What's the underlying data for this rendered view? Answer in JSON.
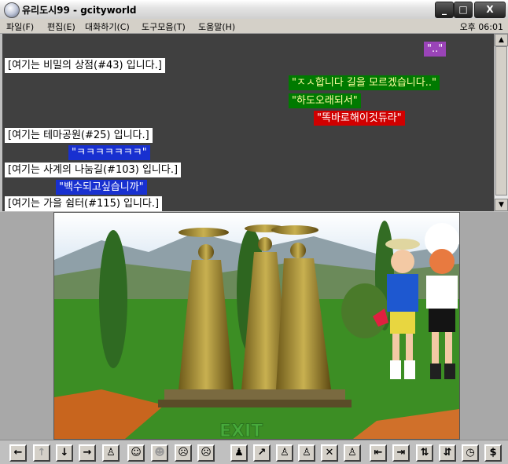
{
  "window": {
    "title": "유리도시99 - gcityworld",
    "minimize": "_",
    "maximize": "□",
    "close": "X"
  },
  "menu": {
    "items": [
      "파일(F)",
      "편집(E)",
      "대화하기(C)",
      "도구모음(T)",
      "도움말(H)"
    ],
    "clock": "오후 06:01"
  },
  "chat": {
    "lines": [
      {
        "text": "\"..\"",
        "style": "p"
      },
      {
        "text": "[여기는  비밀의 상점(#43) 입니다.]",
        "style": "sys"
      },
      {
        "text": "\"ㅈㅅ합니다 길을 모르겠습니다..\"",
        "style": "g"
      },
      {
        "text": "\"하도오래되서\"",
        "style": "g"
      },
      {
        "text": "\"똑바로해이것듀라\"",
        "style": "r"
      },
      {
        "text": "[여기는  테마공원(#25) 입니다.]",
        "style": "sys"
      },
      {
        "text": "\"ㅋㅋㅋㅋㅋㅋㅋ\"",
        "style": "b"
      },
      {
        "text": "[여기는  사계의 나눔길(#103) 입니다.]",
        "style": "sys"
      },
      {
        "text": "\"백수되고싶습니까\"",
        "style": "b"
      },
      {
        "text": "[여기는  가을 쉼터(#115) 입니다.]",
        "style": "sys"
      }
    ]
  },
  "scrollbar": {
    "up": "▲",
    "down": "▼"
  },
  "scene": {
    "exit_sign": "EXIT"
  },
  "toolbar": {
    "buttons": [
      {
        "icon": "arrow-left-icon",
        "glyph": "←"
      },
      {
        "icon": "arrow-up-icon",
        "glyph": "↑"
      },
      {
        "icon": "arrow-down-icon",
        "glyph": "↓"
      },
      {
        "icon": "arrow-right-icon",
        "glyph": "→"
      },
      {
        "icon": "person-icon",
        "glyph": "♙"
      },
      {
        "icon": "face-neutral-icon",
        "glyph": "☺"
      },
      {
        "icon": "face-smile-icon",
        "glyph": "☻"
      },
      {
        "icon": "face-sad-icon",
        "glyph": "☹"
      },
      {
        "icon": "face-angry-icon",
        "glyph": "☹"
      },
      {
        "icon": "pose-sit-icon",
        "glyph": "♟"
      },
      {
        "icon": "pose-point-icon",
        "glyph": "↗"
      },
      {
        "icon": "pose-stand-icon",
        "glyph": "♙"
      },
      {
        "icon": "pose-wave-icon",
        "glyph": "♙"
      },
      {
        "icon": "pose-cross-icon",
        "glyph": "✕"
      },
      {
        "icon": "pose-dance-icon",
        "glyph": "♙"
      },
      {
        "icon": "enter-door-icon",
        "glyph": "⇤"
      },
      {
        "icon": "exit-door-icon",
        "glyph": "⇥"
      },
      {
        "icon": "sort-up-icon",
        "glyph": "⇅"
      },
      {
        "icon": "sort-down-icon",
        "glyph": "⇵"
      },
      {
        "icon": "clock-icon",
        "glyph": "◷"
      },
      {
        "icon": "dollar-icon",
        "glyph": "$"
      }
    ]
  }
}
